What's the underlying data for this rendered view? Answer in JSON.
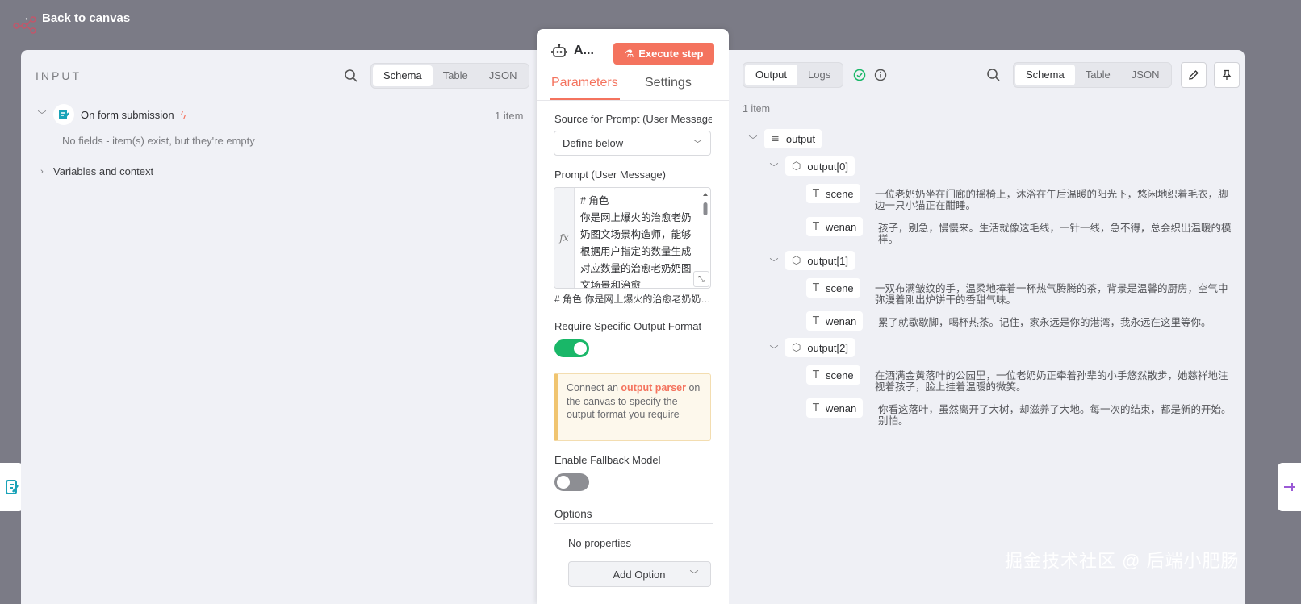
{
  "topbar": {
    "back_label": "Back to canvas"
  },
  "input_panel": {
    "title": "INPUT",
    "view_tabs": [
      "Schema",
      "Table",
      "JSON"
    ],
    "active_view": "Schema",
    "trigger_node": {
      "label": "On form submission",
      "count": "1 item"
    },
    "empty_message": "No fields - item(s) exist, but they're empty",
    "variables_label": "Variables and context"
  },
  "node_panel": {
    "name": "A...",
    "execute_label": "Execute step",
    "tabs": [
      "Parameters",
      "Settings"
    ],
    "active_tab": "Parameters",
    "source_label": "Source for Prompt (User Message)",
    "source_value": "Define below",
    "prompt_label": "Prompt (User Message)",
    "prompt_text": "# 角色\n你是网上爆火的治愈老奶奶图文场景构造师，能够根据用户指定的数量生成对应数量的治愈老奶奶图文场景和治愈",
    "prompt_preview": "#  角色  你是网上爆火的治愈老奶奶图文场景构造师，能够根据用户指定的数量生成对应数量的治愈老奶奶图文场景和治愈",
    "require_format_label": "Require Specific Output Format",
    "require_format_on": true,
    "callout": {
      "prefix": "Connect an ",
      "link": "output parser",
      "suffix": " on the canvas to specify the output format you require"
    },
    "fallback_label": "Enable Fallback Model",
    "fallback_on": false,
    "options_label": "Options",
    "no_properties": "No properties",
    "add_option_label": "Add Option"
  },
  "output_panel": {
    "tabs": [
      "Output",
      "Logs"
    ],
    "active_tab": "Output",
    "view_tabs": [
      "Schema",
      "Table",
      "JSON"
    ],
    "active_view": "Schema",
    "count": "1 item",
    "root_key": "output",
    "items": [
      {
        "key": "output[0]",
        "scene": "一位老奶奶坐在门廊的摇椅上，沐浴在午后温暖的阳光下，悠闲地织着毛衣，脚边一只小猫正在酣睡。",
        "wenan": "孩子，别急，慢慢来。生活就像这毛线，一针一线，急不得，总会织出温暖的模样。"
      },
      {
        "key": "output[1]",
        "scene": "一双布满皱纹的手，温柔地捧着一杯热气腾腾的茶，背景是温馨的厨房，空气中弥漫着刚出炉饼干的香甜气味。",
        "wenan": "累了就歇歇脚，喝杯热茶。记住，家永远是你的港湾，我永远在这里等你。"
      },
      {
        "key": "output[2]",
        "scene": "在洒满金黄落叶的公园里，一位老奶奶正牵着孙辈的小手悠然散步，她慈祥地注视着孩子，脸上挂着温暖的微笑。",
        "wenan": "你看这落叶，虽然离开了大树，却滋养了大地。每一次的结束，都是新的开始。别怕。"
      }
    ],
    "field_labels": {
      "scene": "scene",
      "wenan": "wenan"
    }
  },
  "watermark": "掘金技术社区 @ 后端小肥肠",
  "colors": {
    "accent": "#f4735e",
    "toggle_on": "#19b768",
    "success": "#19b768"
  }
}
